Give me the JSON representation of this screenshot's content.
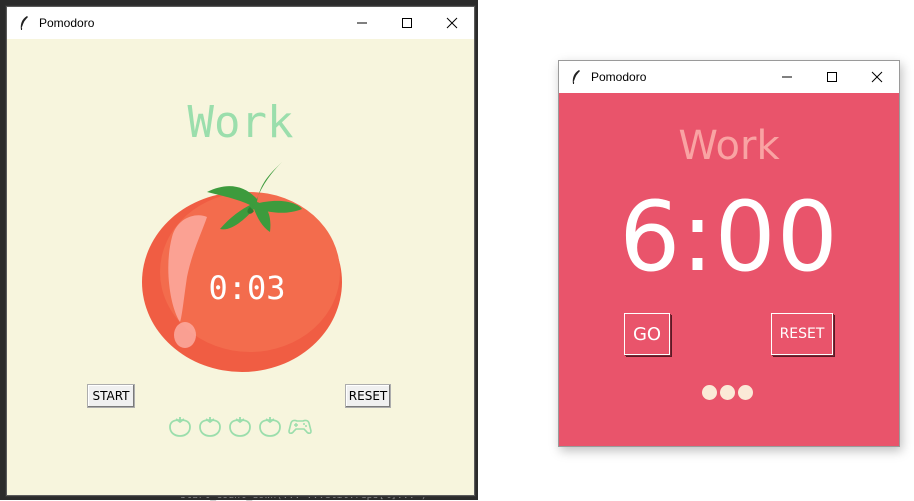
{
  "left_window": {
    "title": "Pomodoro",
    "heading": "Work",
    "timer": "0:03",
    "start_label": "START",
    "reset_label": "RESET",
    "check_marks": [
      "tomato-icon",
      "tomato-icon",
      "tomato-icon",
      "tomato-icon",
      "gamepad-icon"
    ],
    "colors": {
      "background": "#f7f5dd",
      "heading": "#9bdeac",
      "tomato": "#f26849"
    }
  },
  "right_window": {
    "title": "Pomodoro",
    "heading": "Work",
    "timer": "6:00",
    "go_label": "GO",
    "reset_label": "RESET",
    "completed_sessions": 3,
    "colors": {
      "background": "#e9546b",
      "heading": "#f9a3a3",
      "dots": "#fbe9d7"
    }
  },
  "background_code": "start_count_down(...  ...elit.reps[%]... )"
}
